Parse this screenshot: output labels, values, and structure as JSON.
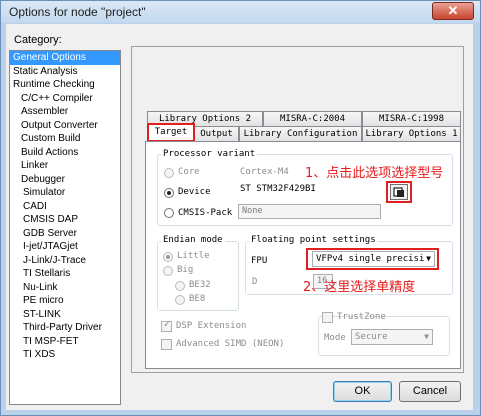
{
  "window": {
    "title": "Options for node \"project\"",
    "close_glyph": "✕"
  },
  "sidebar": {
    "label": "Category:",
    "items": [
      {
        "label": "General Options",
        "selected": true,
        "level": 0
      },
      {
        "label": "Static Analysis",
        "level": 0
      },
      {
        "label": "Runtime Checking",
        "level": 0
      },
      {
        "label": "C/C++ Compiler",
        "level": 1
      },
      {
        "label": "Assembler",
        "level": 1
      },
      {
        "label": "Output Converter",
        "level": 1
      },
      {
        "label": "Custom Build",
        "level": 1
      },
      {
        "label": "Build Actions",
        "level": 1
      },
      {
        "label": "Linker",
        "level": 1
      },
      {
        "label": "Debugger",
        "level": 1
      },
      {
        "label": "Simulator",
        "level": 2
      },
      {
        "label": "CADI",
        "level": 2
      },
      {
        "label": "CMSIS DAP",
        "level": 2
      },
      {
        "label": "GDB Server",
        "level": 2
      },
      {
        "label": "I-jet/JTAGjet",
        "level": 2
      },
      {
        "label": "J-Link/J-Trace",
        "level": 2
      },
      {
        "label": "TI Stellaris",
        "level": 2
      },
      {
        "label": "Nu-Link",
        "level": 2
      },
      {
        "label": "PE micro",
        "level": 2
      },
      {
        "label": "ST-LINK",
        "level": 2
      },
      {
        "label": "Third-Party Driver",
        "level": 2
      },
      {
        "label": "TI MSP-FET",
        "level": 2
      },
      {
        "label": "TI XDS",
        "level": 2
      }
    ]
  },
  "tabs": {
    "row_back": [
      "Library Options 2",
      "MISRA-C:2004",
      "MISRA-C:1998"
    ],
    "row_front": [
      "Target",
      "Output",
      "Library Configuration",
      "Library Options 1"
    ],
    "active": "Target"
  },
  "processor": {
    "group_title": "Processor variant",
    "core_label": "Core",
    "core_value": "Cortex-M4",
    "device_label": "Device",
    "device_value": "ST STM32F429BI",
    "cmsis_label": "CMSIS-Pack",
    "cmsis_value": "None"
  },
  "endian": {
    "group_title": "Endian mode",
    "little": "Little",
    "big": "Big",
    "be32": "BE32",
    "be8": "BE8"
  },
  "fpu": {
    "group_title": "Floating point settings",
    "fpu_label": "FPU",
    "fpu_value": "VFPv4 single precisi",
    "d_label": "D",
    "d_value": "16"
  },
  "options": {
    "dsp": "DSP Extension",
    "simd": "Advanced SIMD (NEON)"
  },
  "trustzone": {
    "label": "TrustZone",
    "mode_label": "Mode",
    "mode_value": "Secure"
  },
  "annotations": {
    "note1": "1、点击此选项选择型号",
    "note2": "2、这里选择单精度",
    "color": "#e81b1b"
  },
  "buttons": {
    "ok": "OK",
    "cancel": "Cancel"
  }
}
